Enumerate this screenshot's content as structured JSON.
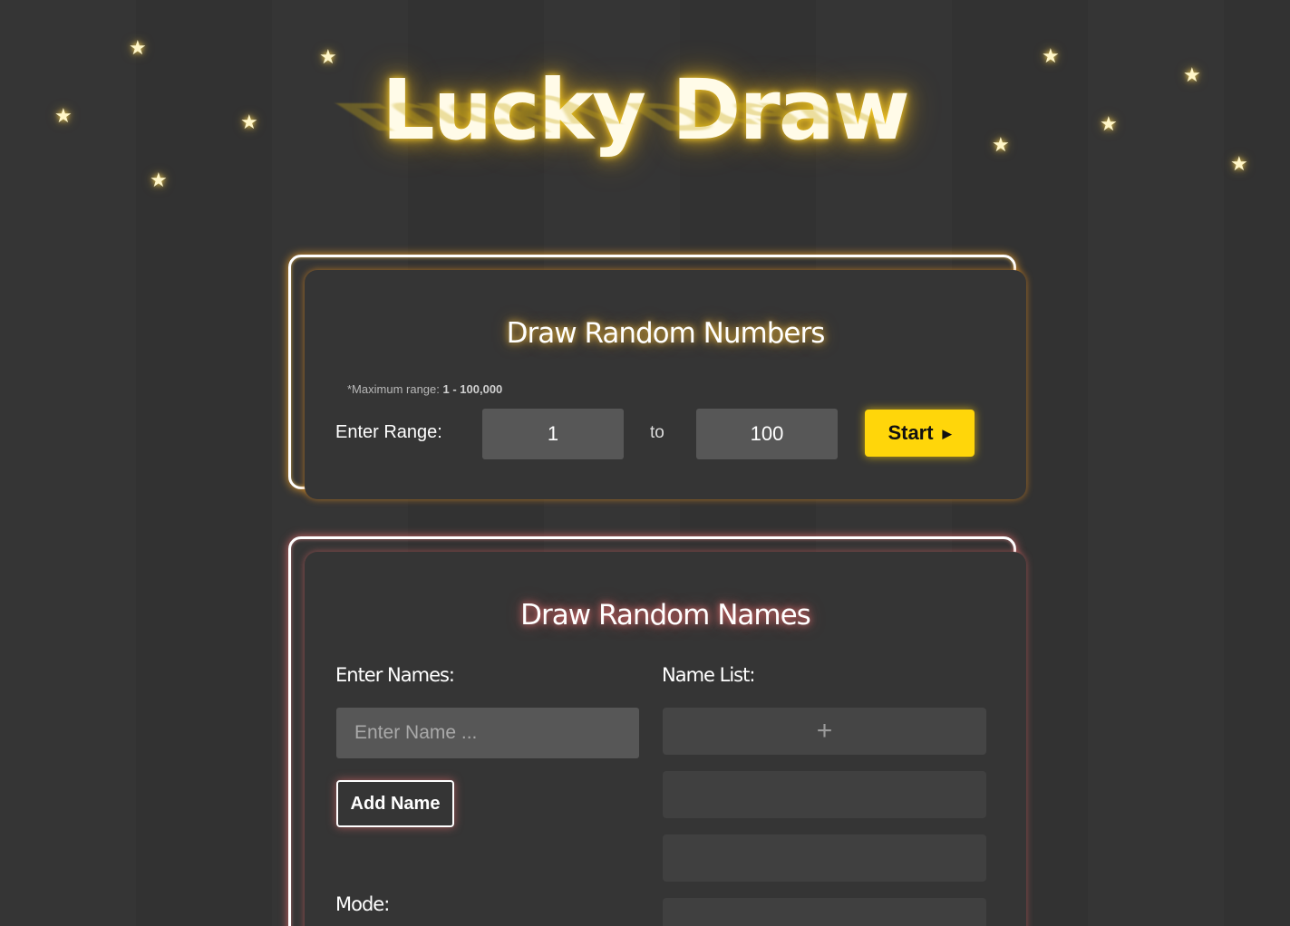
{
  "title": "Lucky Draw",
  "colors": {
    "background": "#333333",
    "accent_yellow": "#ffd60a",
    "glow_numbers": "#ffaa28",
    "glow_names": "#f06e6e"
  },
  "numbers_card": {
    "title": "Draw Random Numbers",
    "hint_prefix": "*Maximum range:",
    "hint_range": "1 - 100,000",
    "range_label": "Enter Range:",
    "from_value": "1",
    "to_label": "to",
    "to_value": "100",
    "start_button": "Start",
    "start_icon": "chevron-right-icon"
  },
  "names_card": {
    "title": "Draw Random Names",
    "enter_names_label": "Enter Names:",
    "name_input_placeholder": "Enter Name ...",
    "add_name_button": "Add Name",
    "name_list_label": "Name List:",
    "add_slot_icon": "plus-icon",
    "mode_label": "Mode:"
  },
  "decorations": {
    "star_icon": "star-icon",
    "star_count": 11
  }
}
